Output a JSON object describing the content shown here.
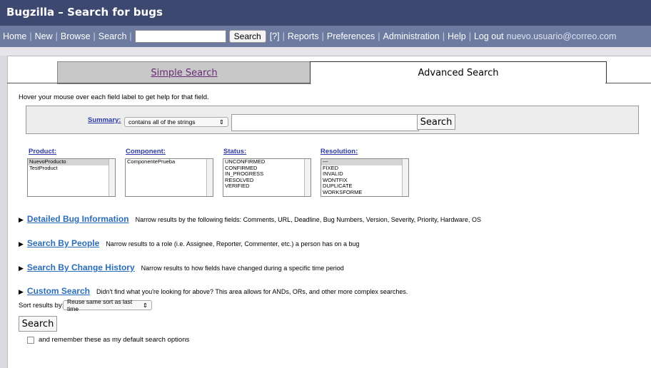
{
  "header": {
    "title": "Bugzilla – Search for bugs"
  },
  "nav": {
    "home": "Home",
    "new": "New",
    "browse": "Browse",
    "search": "Search",
    "quick_search_value": "",
    "search_button": "Search",
    "help_link": "[?]",
    "reports": "Reports",
    "preferences": "Preferences",
    "administration": "Administration",
    "help": "Help",
    "logout": "Log out",
    "user": "nuevo.usuario@correo.com"
  },
  "tabs": {
    "simple": "Simple Search",
    "advanced": "Advanced Search"
  },
  "hint": "Hover your mouse over each field label to get help for that field.",
  "summary": {
    "label": "Summary:",
    "operator": "contains all of the strings",
    "value": "",
    "search_button": "Search"
  },
  "fields": {
    "product": {
      "label": "Product:",
      "options": [
        "NuevoProducto",
        "TestProduct"
      ],
      "selected": "NuevoProducto"
    },
    "component": {
      "label": "Component:",
      "options": [
        "ComponentePrueba"
      ]
    },
    "status": {
      "label": "Status:",
      "options": [
        "UNCONFIRMED",
        "CONFIRMED",
        "IN_PROGRESS",
        "RESOLVED",
        "VERIFIED"
      ]
    },
    "resolution": {
      "label": "Resolution:",
      "options": [
        "---",
        "FIXED",
        "INVALID",
        "WONTFIX",
        "DUPLICATE",
        "WORKSFORME"
      ],
      "selected": "---"
    }
  },
  "sections": [
    {
      "title": "Detailed Bug Information",
      "desc": "Narrow results by the following fields: Comments, URL, Deadline, Bug Numbers, Version, Severity, Priority, Hardware, OS"
    },
    {
      "title": "Search By People",
      "desc": "Narrow results to a role (i.e. Assignee, Reporter, Commenter, etc.) a person has on a bug"
    },
    {
      "title": "Search By Change History",
      "desc": "Narrow results to how fields have changed during a specific time period"
    },
    {
      "title": "Custom Search",
      "desc": "Didn't find what you're looking for above? This area allows for ANDs, ORs, and other more complex searches."
    }
  ],
  "sort": {
    "label": "Sort results by:",
    "value": "Reuse same sort as last time"
  },
  "search_button": "Search",
  "remember_label": "and remember these as my default search options"
}
